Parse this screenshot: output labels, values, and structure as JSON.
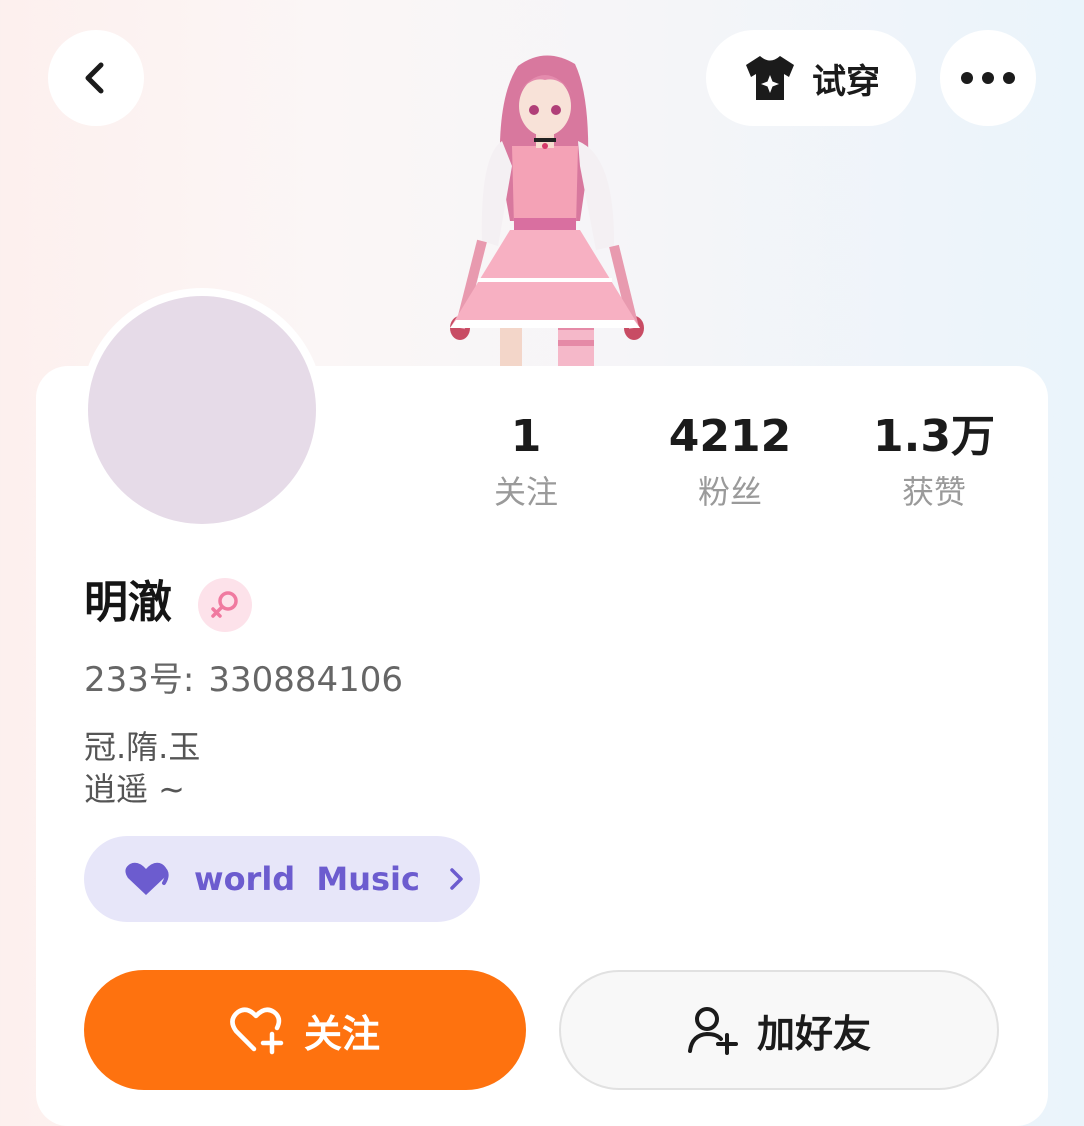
{
  "header": {
    "back_icon": "chevron-left-icon",
    "try_on_icon": "shirt-sparkle-icon",
    "try_on_label": "试穿",
    "more_icon": "more-dots-icon"
  },
  "profile": {
    "name": "明澈",
    "gender_icon": "female-icon",
    "id_label": "233号:",
    "id_value": "330884106",
    "bio_line1": "冠.隋.玉",
    "bio_line2": "逍遥 ~"
  },
  "stats": [
    {
      "value": "1",
      "label": "关注"
    },
    {
      "value": "4212",
      "label": "粉丝"
    },
    {
      "value": "1.3万",
      "label": "获赞"
    }
  ],
  "music_chip": {
    "icon": "heart-music-icon",
    "label": "world  Music"
  },
  "actions": {
    "follow_label": "关注",
    "follow_icon": "heart-plus-icon",
    "add_friend_label": "加好友",
    "add_friend_icon": "user-plus-icon"
  },
  "colors": {
    "accent_orange": "#fe720f",
    "chip_purple": "#6c5ccf",
    "chip_bg": "#e7e6f9",
    "gender_pink": "#f07aa0"
  }
}
